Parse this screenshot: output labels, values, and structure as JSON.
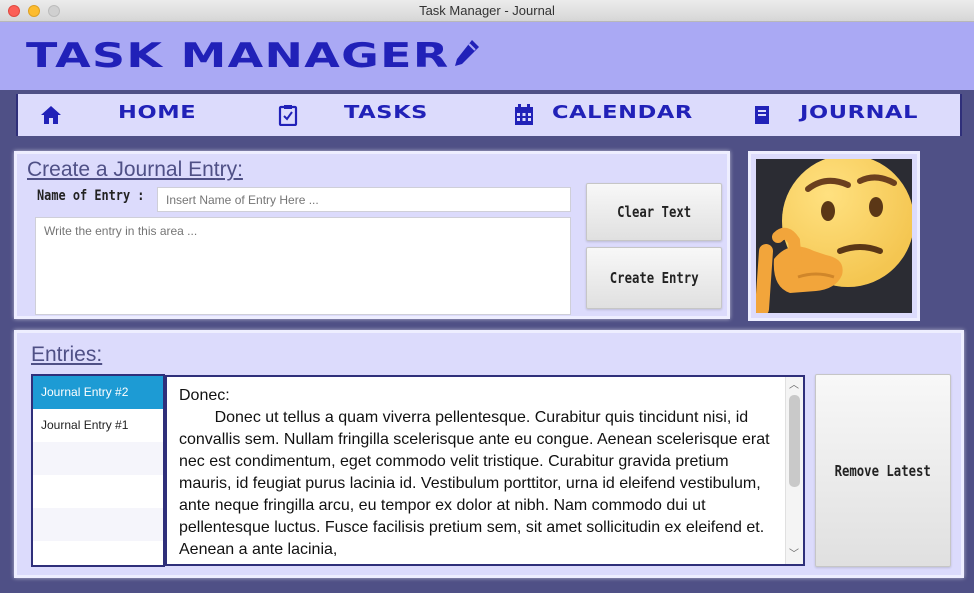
{
  "window": {
    "title": "Task Manager - Journal"
  },
  "header": {
    "brand": "TASK MANAGER"
  },
  "nav": {
    "items": [
      {
        "label": "HOME",
        "icon": "home-icon"
      },
      {
        "label": "TASKS",
        "icon": "clipboard-icon"
      },
      {
        "label": "CALENDAR",
        "icon": "calendar-icon"
      },
      {
        "label": "JOURNAL",
        "icon": "book-icon"
      }
    ]
  },
  "create": {
    "title": "Create a Journal Entry:",
    "name_label": "Name of Entry :",
    "name_placeholder": "Insert Name of Entry Here ...",
    "body_placeholder": "Write the entry in this area ...",
    "clear_label": "Clear Text",
    "create_label": "Create Entry"
  },
  "entries": {
    "title": "Entries:",
    "list": [
      "Journal Entry #2",
      "Journal Entry #1"
    ],
    "selected": "Journal Entry #2",
    "content": "Donec:\n\tDonec ut tellus a quam viverra pellentesque. Curabitur quis tincidunt nisi, id convallis sem. Nullam fringilla scelerisque ante eu congue. Aenean scelerisque erat nec est condimentum, eget commodo velit tristique. Curabitur gravida pretium mauris, id feugiat purus lacinia id. Vestibulum porttitor, urna id eleifend vestibulum, ante neque fringilla arcu, eu tempor ex dolor at nibh. Nam commodo dui ut pellentesque luctus. Fusce facilisis pretium sem, sit amet sollicitudin ex eleifend et. Aenean a ante lacinia,",
    "remove_label": "Remove Latest"
  },
  "colors": {
    "header_bg": "#aaa9f4",
    "brand": "#2121b8",
    "panel_bg": "#dcdbfc",
    "window_bg": "#4f5086",
    "selected_row": "#1d9bd4"
  }
}
